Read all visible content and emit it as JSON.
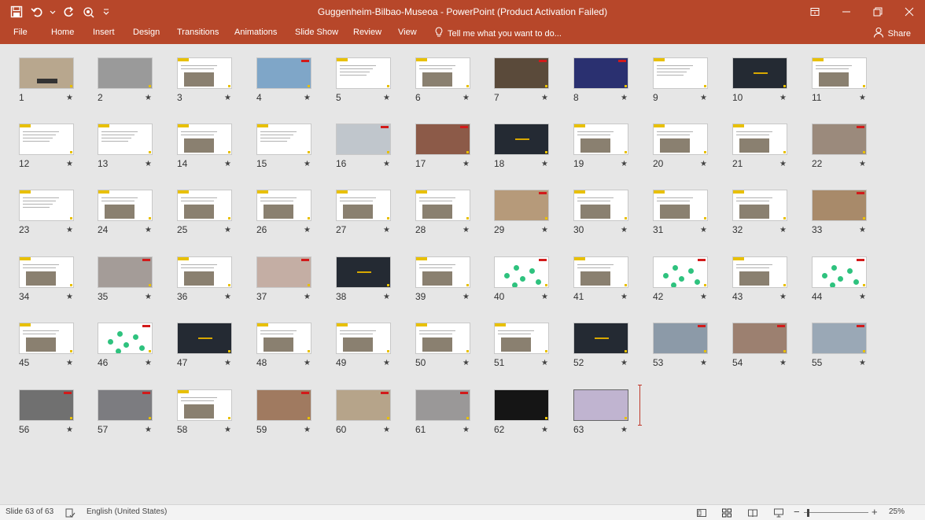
{
  "window": {
    "title": "Guggenheim-Bilbao-Museoa - PowerPoint (Product Activation Failed)",
    "accent_color": "#b7472a"
  },
  "quick_access": {
    "icons": [
      "save-icon",
      "undo-icon",
      "undo-dropdown-icon",
      "redo-icon",
      "present-icon",
      "customize-dropdown-icon"
    ]
  },
  "ribbon": {
    "tabs": [
      "File",
      "Home",
      "Insert",
      "Design",
      "Transitions",
      "Animations",
      "Slide Show",
      "Review",
      "View"
    ],
    "tell_me": "Tell me what you want to do...",
    "share": "Share"
  },
  "slides": [
    {
      "num": "1"
    },
    {
      "num": "2"
    },
    {
      "num": "3"
    },
    {
      "num": "4"
    },
    {
      "num": "5"
    },
    {
      "num": "6"
    },
    {
      "num": "7"
    },
    {
      "num": "8"
    },
    {
      "num": "9"
    },
    {
      "num": "10"
    },
    {
      "num": "11"
    },
    {
      "num": "12"
    },
    {
      "num": "13"
    },
    {
      "num": "14"
    },
    {
      "num": "15"
    },
    {
      "num": "16"
    },
    {
      "num": "17"
    },
    {
      "num": "18"
    },
    {
      "num": "19"
    },
    {
      "num": "20"
    },
    {
      "num": "21"
    },
    {
      "num": "22"
    },
    {
      "num": "23"
    },
    {
      "num": "24"
    },
    {
      "num": "25"
    },
    {
      "num": "26"
    },
    {
      "num": "27"
    },
    {
      "num": "28"
    },
    {
      "num": "29"
    },
    {
      "num": "30"
    },
    {
      "num": "31"
    },
    {
      "num": "32"
    },
    {
      "num": "33"
    },
    {
      "num": "34"
    },
    {
      "num": "35"
    },
    {
      "num": "36"
    },
    {
      "num": "37"
    },
    {
      "num": "38"
    },
    {
      "num": "39"
    },
    {
      "num": "40"
    },
    {
      "num": "41"
    },
    {
      "num": "42"
    },
    {
      "num": "43"
    },
    {
      "num": "44"
    },
    {
      "num": "45"
    },
    {
      "num": "46"
    },
    {
      "num": "47"
    },
    {
      "num": "48"
    },
    {
      "num": "49"
    },
    {
      "num": "50"
    },
    {
      "num": "51"
    },
    {
      "num": "52"
    },
    {
      "num": "53"
    },
    {
      "num": "54"
    },
    {
      "num": "55"
    },
    {
      "num": "56"
    },
    {
      "num": "57"
    },
    {
      "num": "58"
    },
    {
      "num": "59"
    },
    {
      "num": "60"
    },
    {
      "num": "61"
    },
    {
      "num": "62"
    },
    {
      "num": "63"
    }
  ],
  "slide_star": "★",
  "status": {
    "slide_info": "Slide 63 of 63",
    "language": "English (United States)",
    "zoom": "25%",
    "zoom_minus": "−",
    "zoom_plus": "+"
  }
}
